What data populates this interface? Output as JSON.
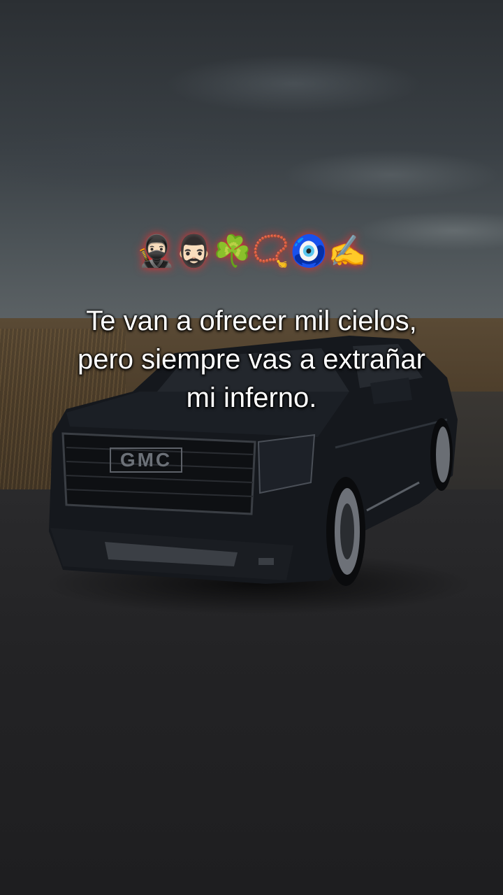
{
  "scene": {
    "description_icons": [
      "ninja",
      "man-with-beard",
      "shamrock",
      "prayer-beads",
      "nazar-amulet",
      "writing-hand"
    ]
  },
  "emojis": "🥷🏻🧔🏻‍♂️☘️📿🧿✍️",
  "caption": {
    "line1": "Te van a ofrecer mil cielos,",
    "line2": "pero siempre vas a extrañar",
    "line3": "mi inferno."
  },
  "truck": {
    "grille_badge": "GMC"
  }
}
